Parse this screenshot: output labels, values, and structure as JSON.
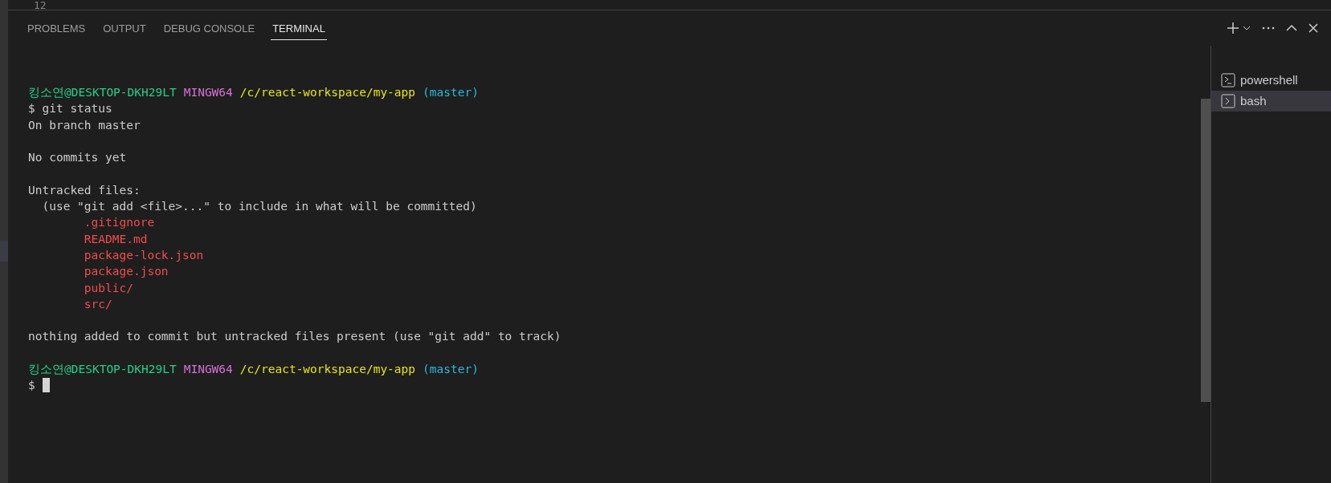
{
  "editor": {
    "line_number": "12"
  },
  "tabs": [
    {
      "label": "PROBLEMS",
      "selected": false
    },
    {
      "label": "OUTPUT",
      "selected": false
    },
    {
      "label": "DEBUG CONSOLE",
      "selected": false
    },
    {
      "label": "TERMINAL",
      "selected": true
    }
  ],
  "terminal": {
    "lines": [
      {
        "kind": "prompt",
        "segments": [
          {
            "text": "킹소연@DESKTOP-DKH29LT",
            "kind": "user"
          },
          {
            "text": "MINGW64",
            "kind": "system"
          },
          {
            "text": "/c/react-workspace/my-app",
            "kind": "path"
          },
          {
            "text": "(master)",
            "kind": "branch"
          }
        ]
      },
      {
        "kind": "text",
        "segments": [
          {
            "text": "$ git status",
            "kind": "plain"
          }
        ]
      },
      {
        "kind": "text",
        "segments": [
          {
            "text": "On branch master",
            "kind": "plain"
          }
        ]
      },
      {
        "kind": "blank"
      },
      {
        "kind": "text",
        "segments": [
          {
            "text": "No commits yet",
            "kind": "plain"
          }
        ]
      },
      {
        "kind": "blank"
      },
      {
        "kind": "text",
        "segments": [
          {
            "text": "Untracked files:",
            "kind": "plain"
          }
        ]
      },
      {
        "kind": "text",
        "segments": [
          {
            "text": "  (use \"git add <file>...\" to include in what will be committed)",
            "kind": "plain"
          }
        ]
      },
      {
        "kind": "text",
        "segments": [
          {
            "text": "        .gitignore",
            "kind": "untracked"
          }
        ]
      },
      {
        "kind": "text",
        "segments": [
          {
            "text": "        README.md",
            "kind": "untracked"
          }
        ]
      },
      {
        "kind": "text",
        "segments": [
          {
            "text": "        package-lock.json",
            "kind": "untracked"
          }
        ]
      },
      {
        "kind": "text",
        "segments": [
          {
            "text": "        package.json",
            "kind": "untracked"
          }
        ]
      },
      {
        "kind": "text",
        "segments": [
          {
            "text": "        public/",
            "kind": "untracked"
          }
        ]
      },
      {
        "kind": "text",
        "segments": [
          {
            "text": "        src/",
            "kind": "untracked"
          }
        ]
      },
      {
        "kind": "blank"
      },
      {
        "kind": "text",
        "segments": [
          {
            "text": "nothing added to commit but untracked files present (use \"git add\" to track)",
            "kind": "plain"
          }
        ]
      },
      {
        "kind": "blank"
      },
      {
        "kind": "prompt",
        "segments": [
          {
            "text": "킹소연@DESKTOP-DKH29LT",
            "kind": "user"
          },
          {
            "text": "MINGW64",
            "kind": "system"
          },
          {
            "text": "/c/react-workspace/my-app",
            "kind": "path"
          },
          {
            "text": "(master)",
            "kind": "branch"
          }
        ]
      },
      {
        "kind": "input",
        "segments": [
          {
            "text": "$",
            "kind": "plain"
          }
        ],
        "cursor": true
      }
    ]
  },
  "terminal_list": [
    {
      "label": "powershell",
      "kind": "powershell",
      "selected": false
    },
    {
      "label": "bash",
      "kind": "bash",
      "selected": true
    }
  ]
}
